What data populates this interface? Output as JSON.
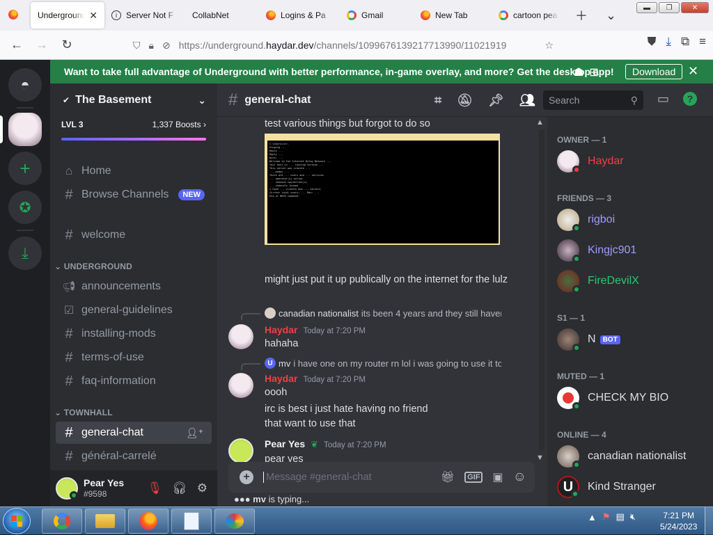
{
  "browser": {
    "tabs": [
      {
        "label": "Underground",
        "icon": "firefox-icon",
        "active": true
      },
      {
        "label": "Server Not F",
        "icon": "info-icon"
      },
      {
        "label": "CollabNet",
        "icon": "none"
      },
      {
        "label": "Logins & Pa",
        "icon": "firefox-icon"
      },
      {
        "label": "Gmail",
        "icon": "google-icon"
      },
      {
        "label": "New Tab",
        "icon": "firefox-icon"
      },
      {
        "label": "cartoon pea",
        "icon": "google-icon"
      }
    ],
    "url_prefix": "https://underground.",
    "url_domain": "haydar.dev",
    "url_path": "/channels/1099676139217713990/11021919"
  },
  "notice": {
    "text": "Want to take full advantage of Underground with better performance, in-game overlay, and more? Get the desktop app!",
    "download": "Download"
  },
  "server": {
    "name": "The Basement",
    "level": "LVL 3",
    "boosts": "1,337 Boosts",
    "home": "Home",
    "browse": "Browse Channels",
    "new_badge": "NEW",
    "welcome": "welcome",
    "cat_underground": "UNDERGROUND",
    "cat_townhall": "TOWNHALL",
    "channels_underground": [
      "announcements",
      "general-guidelines",
      "installing-mods",
      "terms-of-use",
      "faq-information"
    ],
    "channels_townhall": [
      "general-chat",
      "général-carrelé"
    ]
  },
  "user": {
    "name": "Pear Yes",
    "tag": "#9598"
  },
  "chat": {
    "channel": "general-chat",
    "search_placeholder": "Search",
    "composer_placeholder": "Message #general-chat",
    "typing_user": "mv",
    "typing_suffix": " is typing...",
    "messages": {
      "m1_text": "test various things but forgot to do so",
      "m2_text": "might just put it up publically on the internet for the lulz",
      "reply1_name": "canadian nationalist",
      "reply1_text": "its been 4 years and they still haven'",
      "haydar_name": "Haydar",
      "time": "Today at 7:20 PM",
      "m3_text": "hahaha",
      "reply2_name": "mv",
      "reply2_text": "i have one on my router rn lol i was going to use it to te",
      "m4_text": "oooh",
      "m5_text": "irc is best i just hate having no friend",
      "m6_text": "that want to use that",
      "pear_name": "Pear Yes",
      "m7_text": "pear yes"
    }
  },
  "members": {
    "owner_cat": "OWNER — 1",
    "owner": "Haydar",
    "friends_cat": "FRIENDS — 3",
    "friends": [
      "rigboi",
      "Kingjc901",
      "FireDevilX"
    ],
    "s1_cat": "S1 — 1",
    "s1_member": "N",
    "bot_badge": "BOT",
    "muted_cat": "MUTED — 1",
    "muted_member": "CHECK MY BIO",
    "online_cat": "ONLINE — 4",
    "online": [
      "canadian nationalist",
      "Kind Stranger"
    ]
  },
  "taskbar": {
    "time": "7:21 PM",
    "date": "5/24/2023"
  },
  "colors": {
    "accent_green": "#248046",
    "owner_red": "#f23f43",
    "friend_purple": "#a29bfe",
    "firedevil_green": "#2dc770",
    "blurple": "#5865f2"
  }
}
